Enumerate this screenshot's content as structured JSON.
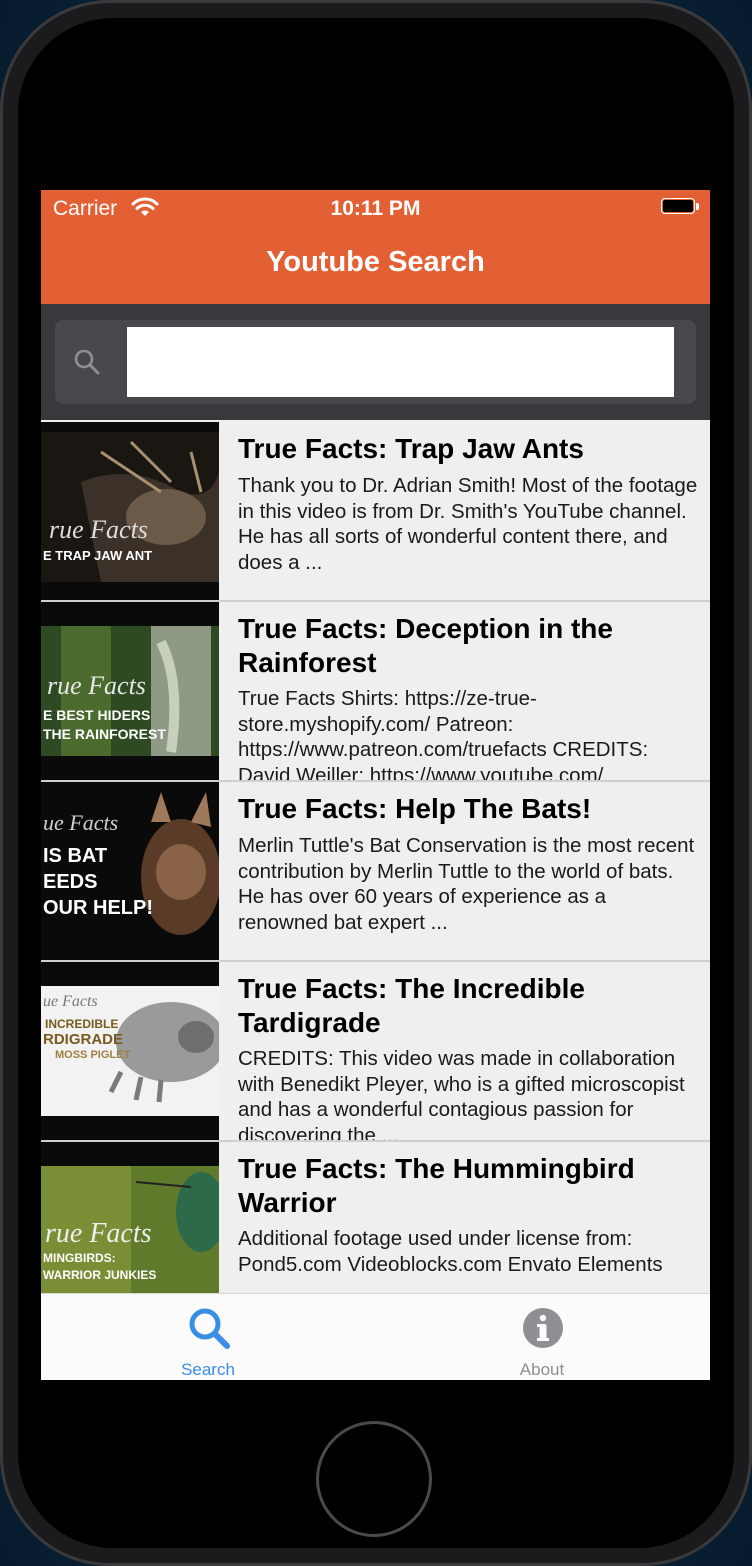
{
  "status": {
    "carrier": "Carrier",
    "time": "10:11 PM"
  },
  "nav": {
    "title": "Youtube Search"
  },
  "search": {
    "placeholder": "",
    "value": ""
  },
  "videos": [
    {
      "title": "True Facts: Trap Jaw Ants",
      "description": "Thank you to Dr. Adrian Smith! Most of the footage in this video is from Dr. Smith's YouTube channel. He has all sorts of wonderful content there, and does a ...",
      "thumb_text": [
        "rue Facts",
        "E TRAP JAW ANT"
      ]
    },
    {
      "title": "True Facts: Deception in the Rainforest",
      "description": "True Facts Shirts: https://ze-true-store.myshopify.com/ Patreon: https://www.patreon.com/truefacts CREDITS: David Weiller: https://www.youtube.com/",
      "thumb_text": [
        "rue Facts",
        "E BEST HIDERS",
        "THE RAINFOREST"
      ]
    },
    {
      "title": "True Facts: Help The Bats!",
      "description": "Merlin Tuttle's Bat Conservation is the most recent contribution by Merlin Tuttle to the world of bats. He has over 60 years of experience as a renowned bat expert ...",
      "thumb_text": [
        "ue Facts",
        "IS BAT",
        "EEDS",
        "OUR HELP!"
      ]
    },
    {
      "title": "True Facts: The Incredible Tardigrade",
      "description": "CREDITS: This video was made in collaboration with Benedikt Pleyer, who is a gifted microscopist and has a wonderful contagious passion for discovering the ...",
      "thumb_text": [
        "ue Facts",
        "INCREDIBLE",
        "RDIGRADE",
        "MOSS PIGLET"
      ]
    },
    {
      "title": "True Facts: The Hummingbird Warrior",
      "description": "Additional footage used under license from: Pond5.com Videoblocks.com Envato Elements",
      "thumb_text": [
        "rue Facts",
        "MINGBIRDS:",
        "WARRIOR JUNKIES"
      ]
    }
  ],
  "tabs": {
    "search_label": "Search",
    "about_label": "About"
  },
  "colors": {
    "accent": "#e35f34",
    "tab_active": "#3a8ee6",
    "tab_inactive": "#8e8e93"
  }
}
